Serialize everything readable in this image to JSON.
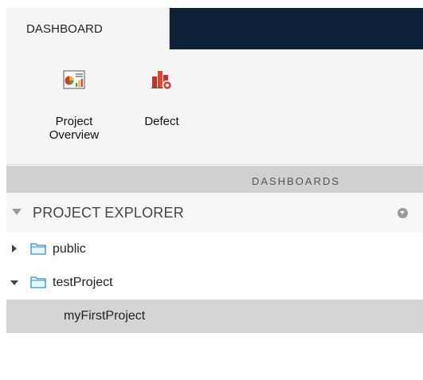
{
  "tabs": [
    {
      "label": "DASHBOARD"
    }
  ],
  "toolstrip": {
    "project_overview_label": "Project\nOverview",
    "defect_label": "Defect",
    "section_label": "DASHBOARDS"
  },
  "explorer": {
    "title": "PROJECT EXPLORER",
    "items": [
      {
        "label": "public",
        "expanded": false
      },
      {
        "label": "testProject",
        "expanded": true
      },
      {
        "label": "myFirstProject",
        "selected": true
      }
    ]
  },
  "colors": {
    "tab_strip_dark": "#0d2139",
    "toolstrip_bg": "#f5f5f5",
    "section_bar": "#d0d0d0",
    "selection": "#d5d5d5",
    "folder": "#2f8fd3"
  }
}
